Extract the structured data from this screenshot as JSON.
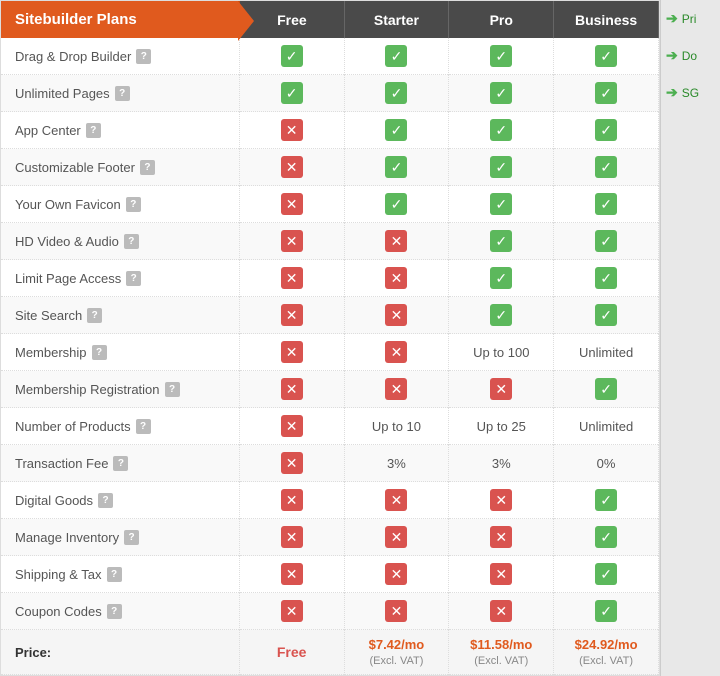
{
  "header": {
    "col_feature": "Sitebuilder Plans",
    "col_free": "Free",
    "col_starter": "Starter",
    "col_pro": "Pro",
    "col_business": "Business"
  },
  "sidebar": {
    "items": [
      {
        "label": "Pri",
        "id": "pri"
      },
      {
        "label": "Do",
        "id": "do"
      },
      {
        "label": "SG",
        "id": "sg"
      }
    ]
  },
  "rows": [
    {
      "feature": "Drag & Drop Builder",
      "free": "check",
      "starter": "check",
      "pro": "check",
      "business": "check"
    },
    {
      "feature": "Unlimited Pages",
      "free": "check",
      "starter": "check",
      "pro": "check",
      "business": "check"
    },
    {
      "feature": "App Center",
      "free": "cross",
      "starter": "check",
      "pro": "check",
      "business": "check"
    },
    {
      "feature": "Customizable Footer",
      "free": "cross",
      "starter": "check",
      "pro": "check",
      "business": "check"
    },
    {
      "feature": "Your Own Favicon",
      "free": "cross",
      "starter": "check",
      "pro": "check",
      "business": "check"
    },
    {
      "feature": "HD Video & Audio",
      "free": "cross",
      "starter": "cross",
      "pro": "check",
      "business": "check"
    },
    {
      "feature": "Limit Page Access",
      "free": "cross",
      "starter": "cross",
      "pro": "check",
      "business": "check"
    },
    {
      "feature": "Site Search",
      "free": "cross",
      "starter": "cross",
      "pro": "check",
      "business": "check"
    },
    {
      "feature": "Membership",
      "free": "cross",
      "starter": "cross",
      "pro": "Up to 100",
      "business": "Unlimited"
    },
    {
      "feature": "Membership Registration",
      "free": "cross",
      "starter": "cross",
      "pro": "cross",
      "business": "check"
    },
    {
      "feature": "Number of Products",
      "free": "cross",
      "starter": "Up to 10",
      "pro": "Up to 25",
      "business": "Unlimited"
    },
    {
      "feature": "Transaction Fee",
      "free": "cross",
      "starter": "3%",
      "pro": "3%",
      "business": "0%"
    },
    {
      "feature": "Digital Goods",
      "free": "cross",
      "starter": "cross",
      "pro": "cross",
      "business": "check"
    },
    {
      "feature": "Manage Inventory",
      "free": "cross",
      "starter": "cross",
      "pro": "cross",
      "business": "check"
    },
    {
      "feature": "Shipping & Tax",
      "free": "cross",
      "starter": "cross",
      "pro": "cross",
      "business": "check"
    },
    {
      "feature": "Coupon Codes",
      "free": "cross",
      "starter": "cross",
      "pro": "cross",
      "business": "check"
    }
  ],
  "price_row": {
    "label": "Price:",
    "free": "Free",
    "starter": "$7.42/mo",
    "starter_note": "(Excl. VAT)",
    "pro": "$11.58/mo",
    "pro_note": "(Excl. VAT)",
    "business": "$24.92/mo",
    "business_note": "(Excl. VAT)"
  },
  "icons": {
    "check": "✓",
    "cross": "✕",
    "help": "?",
    "arrow": "➔"
  }
}
